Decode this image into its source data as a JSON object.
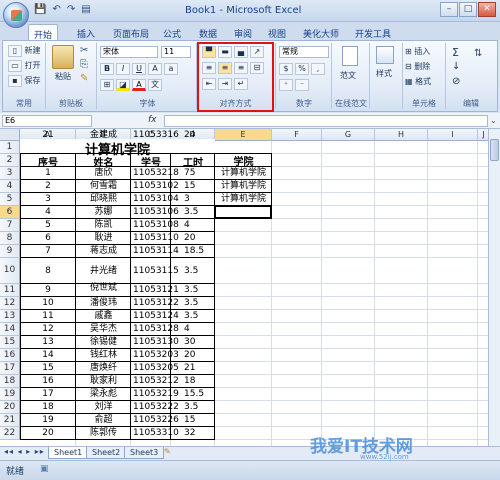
{
  "window": {
    "title": "Book1 - Microsoft Excel"
  },
  "qat": {
    "save_icon": "💾",
    "undo_icon": "↶",
    "redo_icon": "↷",
    "print_icon": "▤"
  },
  "window_buttons": {
    "minimize": "–",
    "restore": "□",
    "close": "✕"
  },
  "tabs": [
    "开始",
    "插入",
    "页面布局",
    "公式",
    "数据",
    "审阅",
    "视图",
    "美化大师",
    "开发工具"
  ],
  "ribbon": {
    "common": {
      "new": "新建",
      "open": "打开",
      "save": "保存",
      "label": "常用"
    },
    "clipboard": {
      "paste": "粘贴",
      "label": "剪贴板"
    },
    "font": {
      "name": "宋体",
      "size": "11",
      "bold": "B",
      "italic": "I",
      "underline": "U",
      "label": "字体"
    },
    "alignment": {
      "label": "对齐方式"
    },
    "number": {
      "format": "常规",
      "percent": "%",
      "comma": ",",
      "label": "数字"
    },
    "styles_group": {
      "style_button": "范文",
      "label": "在线范文"
    },
    "style": {
      "style_label": "样式"
    },
    "cells": {
      "insert": "插入",
      "delete": "删除",
      "format": "格式",
      "label": "单元格"
    },
    "editing": {
      "sum": "Σ",
      "fill": "↓",
      "clear": "⊘",
      "label": "编辑"
    }
  },
  "formula_bar": {
    "name_box": "E6",
    "fx": "fx",
    "value": ""
  },
  "columns": [
    "A",
    "B",
    "C",
    "D",
    "E",
    "F",
    "G",
    "H",
    "I",
    "J"
  ],
  "rows": [
    "1",
    "2",
    "3",
    "4",
    "5",
    "6",
    "7",
    "8",
    "9",
    "10",
    "11",
    "12",
    "13",
    "14",
    "15",
    "16",
    "17",
    "18",
    "19",
    "20",
    "21",
    "22"
  ],
  "sheet_title": "计算机学院",
  "headers": {
    "A": "序号",
    "B": "姓名",
    "C": "学号",
    "D": "工时",
    "E": "学院"
  },
  "records": [
    {
      "no": "1",
      "name": "唐欣",
      "id": "11053218",
      "hours": "75"
    },
    {
      "no": "2",
      "name": "何雪霜",
      "id": "11053102",
      "hours": "15"
    },
    {
      "no": "3",
      "name": "邱晓熙",
      "id": "11053104",
      "hours": "3"
    },
    {
      "no": "4",
      "name": "苏娜",
      "id": "11053106",
      "hours": "3.5"
    },
    {
      "no": "5",
      "name": "陈凯",
      "id": "11053108",
      "hours": "4"
    },
    {
      "no": "6",
      "name": "耿进",
      "id": "11053110",
      "hours": "20"
    },
    {
      "no": "7",
      "name": "蒋志成",
      "id": "11053114",
      "hours": "18.5"
    },
    {
      "no": "8",
      "name": "井光绪",
      "id": "11053115",
      "hours": "3.5"
    },
    {
      "no": "9",
      "name": "倪世斌",
      "id": "11053121",
      "hours": "3.5"
    },
    {
      "no": "10",
      "name": "潘俊玮",
      "id": "11053122",
      "hours": "3.5"
    },
    {
      "no": "11",
      "name": "戚鑫",
      "id": "11053124",
      "hours": "3.5"
    },
    {
      "no": "12",
      "name": "吴华杰",
      "id": "11053128",
      "hours": "4"
    },
    {
      "no": "13",
      "name": "徐锡健",
      "id": "11053130",
      "hours": "30"
    },
    {
      "no": "14",
      "name": "钱红林",
      "id": "11053203",
      "hours": "20"
    },
    {
      "no": "15",
      "name": "唐焕纤",
      "id": "11053205",
      "hours": "21"
    },
    {
      "no": "16",
      "name": "耿家利",
      "id": "11053212",
      "hours": "18"
    },
    {
      "no": "17",
      "name": "梁永彪",
      "id": "11053219",
      "hours": "15.5"
    },
    {
      "no": "18",
      "name": "刘洋",
      "id": "11053222",
      "hours": "3.5"
    },
    {
      "no": "19",
      "name": "俞超",
      "id": "11053226",
      "hours": "15"
    },
    {
      "no": "20",
      "name": "陈郭传",
      "id": "11053310",
      "hours": "32"
    },
    {
      "no": "21",
      "name": "金建成",
      "id": "11053316",
      "hours": "24"
    }
  ],
  "college_values": [
    "计算机学院",
    "计算机学院",
    "计算机学院"
  ],
  "sheets": [
    "Sheet1",
    "Sheet2",
    "Sheet3"
  ],
  "status": {
    "ready": "就绪"
  },
  "watermark": {
    "main": "我爱IT技术网",
    "sub": "www.52ij.com"
  }
}
